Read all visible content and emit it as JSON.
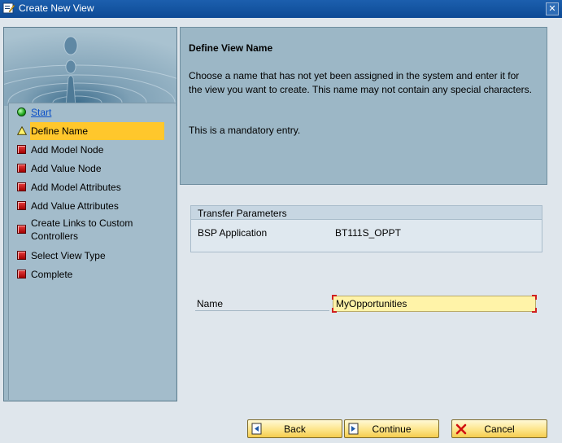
{
  "window": {
    "title": "Create New View",
    "close_symbol": "✕"
  },
  "wizard_steps": [
    {
      "label": "Start",
      "status": "done",
      "icon": "green-circle-icon",
      "link": true
    },
    {
      "label": "Define Name",
      "status": "current",
      "icon": "warning-triangle-icon"
    },
    {
      "label": "Add Model Node",
      "status": "pending",
      "icon": "red-square-icon"
    },
    {
      "label": "Add Value Node",
      "status": "pending",
      "icon": "red-square-icon"
    },
    {
      "label": "Add Model Attributes",
      "status": "pending",
      "icon": "red-square-icon"
    },
    {
      "label": "Add Value Attributes",
      "status": "pending",
      "icon": "red-square-icon"
    },
    {
      "label": "Create Links to Custom Controllers",
      "status": "pending",
      "icon": "red-square-icon"
    },
    {
      "label": "Select View Type",
      "status": "pending",
      "icon": "red-square-icon"
    },
    {
      "label": "Complete",
      "status": "pending",
      "icon": "red-square-icon"
    }
  ],
  "info": {
    "heading": "Define View Name",
    "description": "Choose a name that has not yet been assigned in the system and enter it for the view you want to create. This name may not contain any special characters.",
    "mandatory_note": "This is a mandatory entry."
  },
  "transfer_parameters": {
    "title": "Transfer Parameters",
    "rows": [
      {
        "label": "BSP Application",
        "value": "BT111S_OPPT"
      }
    ]
  },
  "name_field": {
    "label": "Name",
    "value": "MyOpportunities"
  },
  "buttons": {
    "back": "Back",
    "continue": "Continue",
    "cancel": "Cancel"
  },
  "colors": {
    "titlebar": "#0d4a95",
    "panel": "#9cb7c6",
    "current_step_highlight": "#ffc72c",
    "required_field_bg": "#fff3a8",
    "button_bg": "#fde58a"
  }
}
